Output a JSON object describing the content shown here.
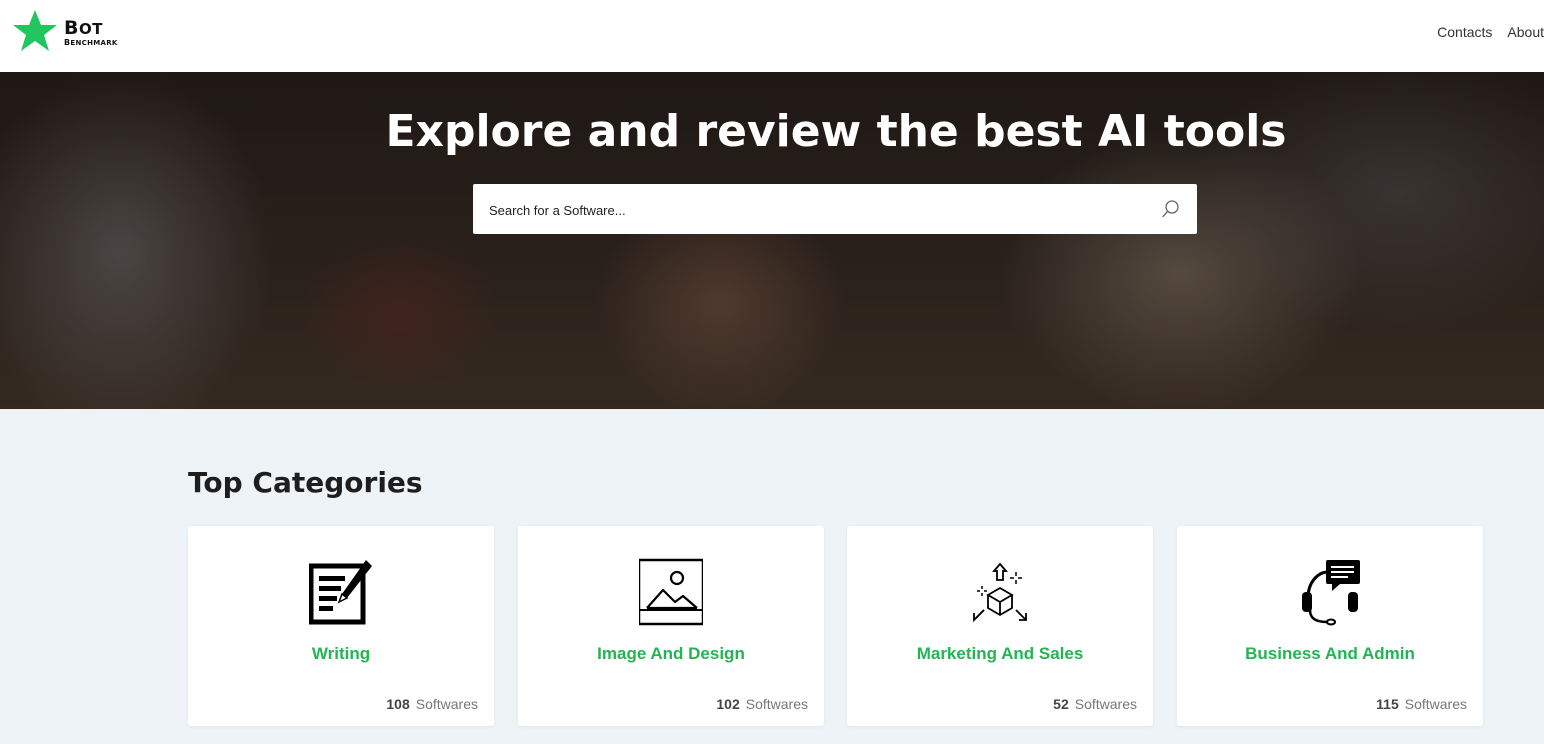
{
  "brand": {
    "name_top": "Bot",
    "name_bottom": "Benchmark",
    "star_color": "#22c55e"
  },
  "nav": {
    "contacts": "Contacts",
    "about": "About"
  },
  "hero": {
    "title": "Explore and review the best AI tools",
    "search_placeholder": "Search for a Software..."
  },
  "categories": {
    "title": "Top Categories",
    "accent_color": "#22b455",
    "unit": "Softwares",
    "items": [
      {
        "label": "Writing",
        "count": "108",
        "icon": "writing-icon"
      },
      {
        "label": "Image And Design",
        "count": "102",
        "icon": "image-icon"
      },
      {
        "label": "Marketing And Sales",
        "count": "52",
        "icon": "marketing-icon"
      },
      {
        "label": "Business And Admin",
        "count": "115",
        "icon": "headset-icon"
      }
    ]
  }
}
